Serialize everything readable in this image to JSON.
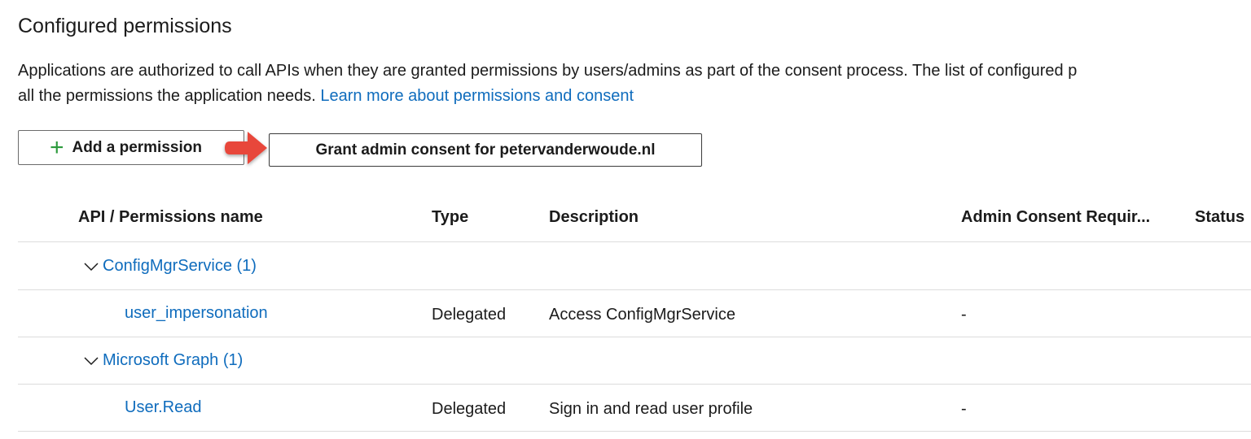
{
  "section": {
    "title": "Configured permissions",
    "description_line1": "Applications are authorized to call APIs when they are granted permissions by users/admins as part of the consent process. The list of configured p",
    "description_line2": "all the permissions the application needs.",
    "learn_more_link": "Learn more about permissions and consent"
  },
  "toolbar": {
    "add_permission_label": "Add a permission",
    "grant_consent_label": "Grant admin consent for petervanderwoude.nl"
  },
  "table": {
    "columns": [
      "API / Permissions name",
      "Type",
      "Description",
      "Admin Consent Requir...",
      "Status"
    ],
    "groups": [
      {
        "name": "ConfigMgrService (1)",
        "permissions": [
          {
            "name": "user_impersonation",
            "type": "Delegated",
            "description": "Access ConfigMgrService",
            "admin_consent": "-"
          }
        ]
      },
      {
        "name": "Microsoft Graph (1)",
        "permissions": [
          {
            "name": "User.Read",
            "type": "Delegated",
            "description": "Sign in and read user profile",
            "admin_consent": "-"
          }
        ]
      }
    ]
  },
  "colors": {
    "link": "#0f6cbd",
    "plus": "#2c9a3c",
    "arrow": "#e8473b"
  },
  "icons": {
    "add": "plus-icon",
    "expand": "chevron-down-icon",
    "pointer": "red-arrow-icon"
  }
}
